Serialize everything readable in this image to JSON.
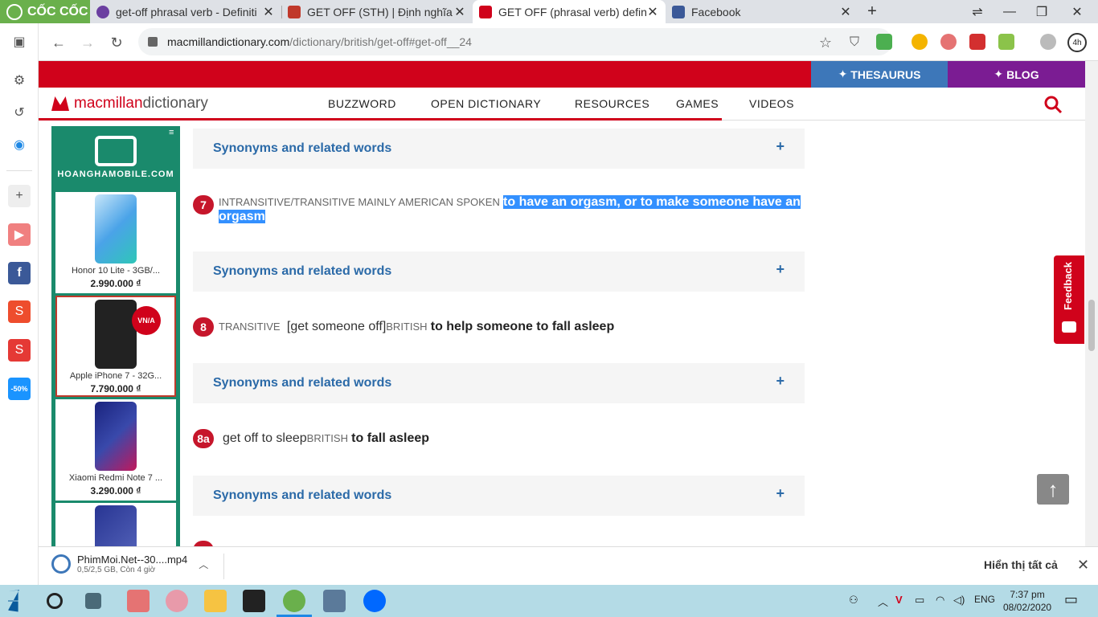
{
  "browser": {
    "brand": "CỐC CỐC",
    "tabs": [
      {
        "title": "get-off phrasal verb - Definiti",
        "favicon_color": "#6b3fa0"
      },
      {
        "title": "GET OFF (STH) | Định nghĩa tr",
        "favicon_color": "#c0392b"
      },
      {
        "title": "GET OFF (phrasal verb) definit",
        "favicon_color": "#d0021b"
      },
      {
        "title": "Facebook",
        "favicon_color": "#3b5998"
      }
    ],
    "new_tab": "+",
    "url_host": "macmillandictionary.com",
    "url_path": "/dictionary/british/get-off#get-off__24",
    "profile_badge": "4h"
  },
  "site": {
    "thesaurus": "THESAURUS",
    "blog": "BLOG",
    "logo_brand": "macmillan",
    "logo_dict": " dictionary",
    "nav": [
      "BUZZWORD",
      "OPEN DICTIONARY",
      "RESOURCES",
      "GAMES",
      "VIDEOS"
    ]
  },
  "ad": {
    "site": "HOANGHAMOBILE.COM",
    "products": [
      {
        "name": "Honor 10 Lite - 3GB/...",
        "price": "2.990.000 ₫",
        "color": "#7fb6e8"
      },
      {
        "name": "Apple iPhone 7 - 32G...",
        "price": "7.790.000 ₫",
        "color": "#222222",
        "badge": "VN/A"
      },
      {
        "name": "Xiaomi Redmi Note 7 ...",
        "price": "3.290.000 ₫",
        "color": "#2a3fc4"
      },
      {
        "name": "",
        "price": "",
        "color": "#3a4fd0"
      }
    ]
  },
  "entry": {
    "synonyms_label": "Synonyms and related words",
    "plus": "+",
    "senses": [
      {
        "num": "7",
        "gram": "INTRANSITIVE/TRANSITIVE  MAINLY AMERICAN  SPOKEN",
        "pattern": "",
        "region": "",
        "definition": "to have an orgasm, or to make someone have an orgasm"
      },
      {
        "num": "8",
        "gram": "TRANSITIVE",
        "pattern": "[get someone off]",
        "region": "BRITISH",
        "definition": "to help someone to fall asleep"
      },
      {
        "num": "8a",
        "gram": "",
        "pattern": "get off to sleep",
        "region": "BRITISH",
        "definition": "to fall asleep"
      }
    ]
  },
  "feedback": "Feedback",
  "download": {
    "filename": "PhimMoi.Net--30....mp4",
    "status": "0,5/2,5 GB, Còn 4 giờ",
    "show_all": "Hiển thị tất cả"
  },
  "taskbar": {
    "lang": "ENG",
    "time": "7:37 pm",
    "date": "08/02/2020"
  }
}
